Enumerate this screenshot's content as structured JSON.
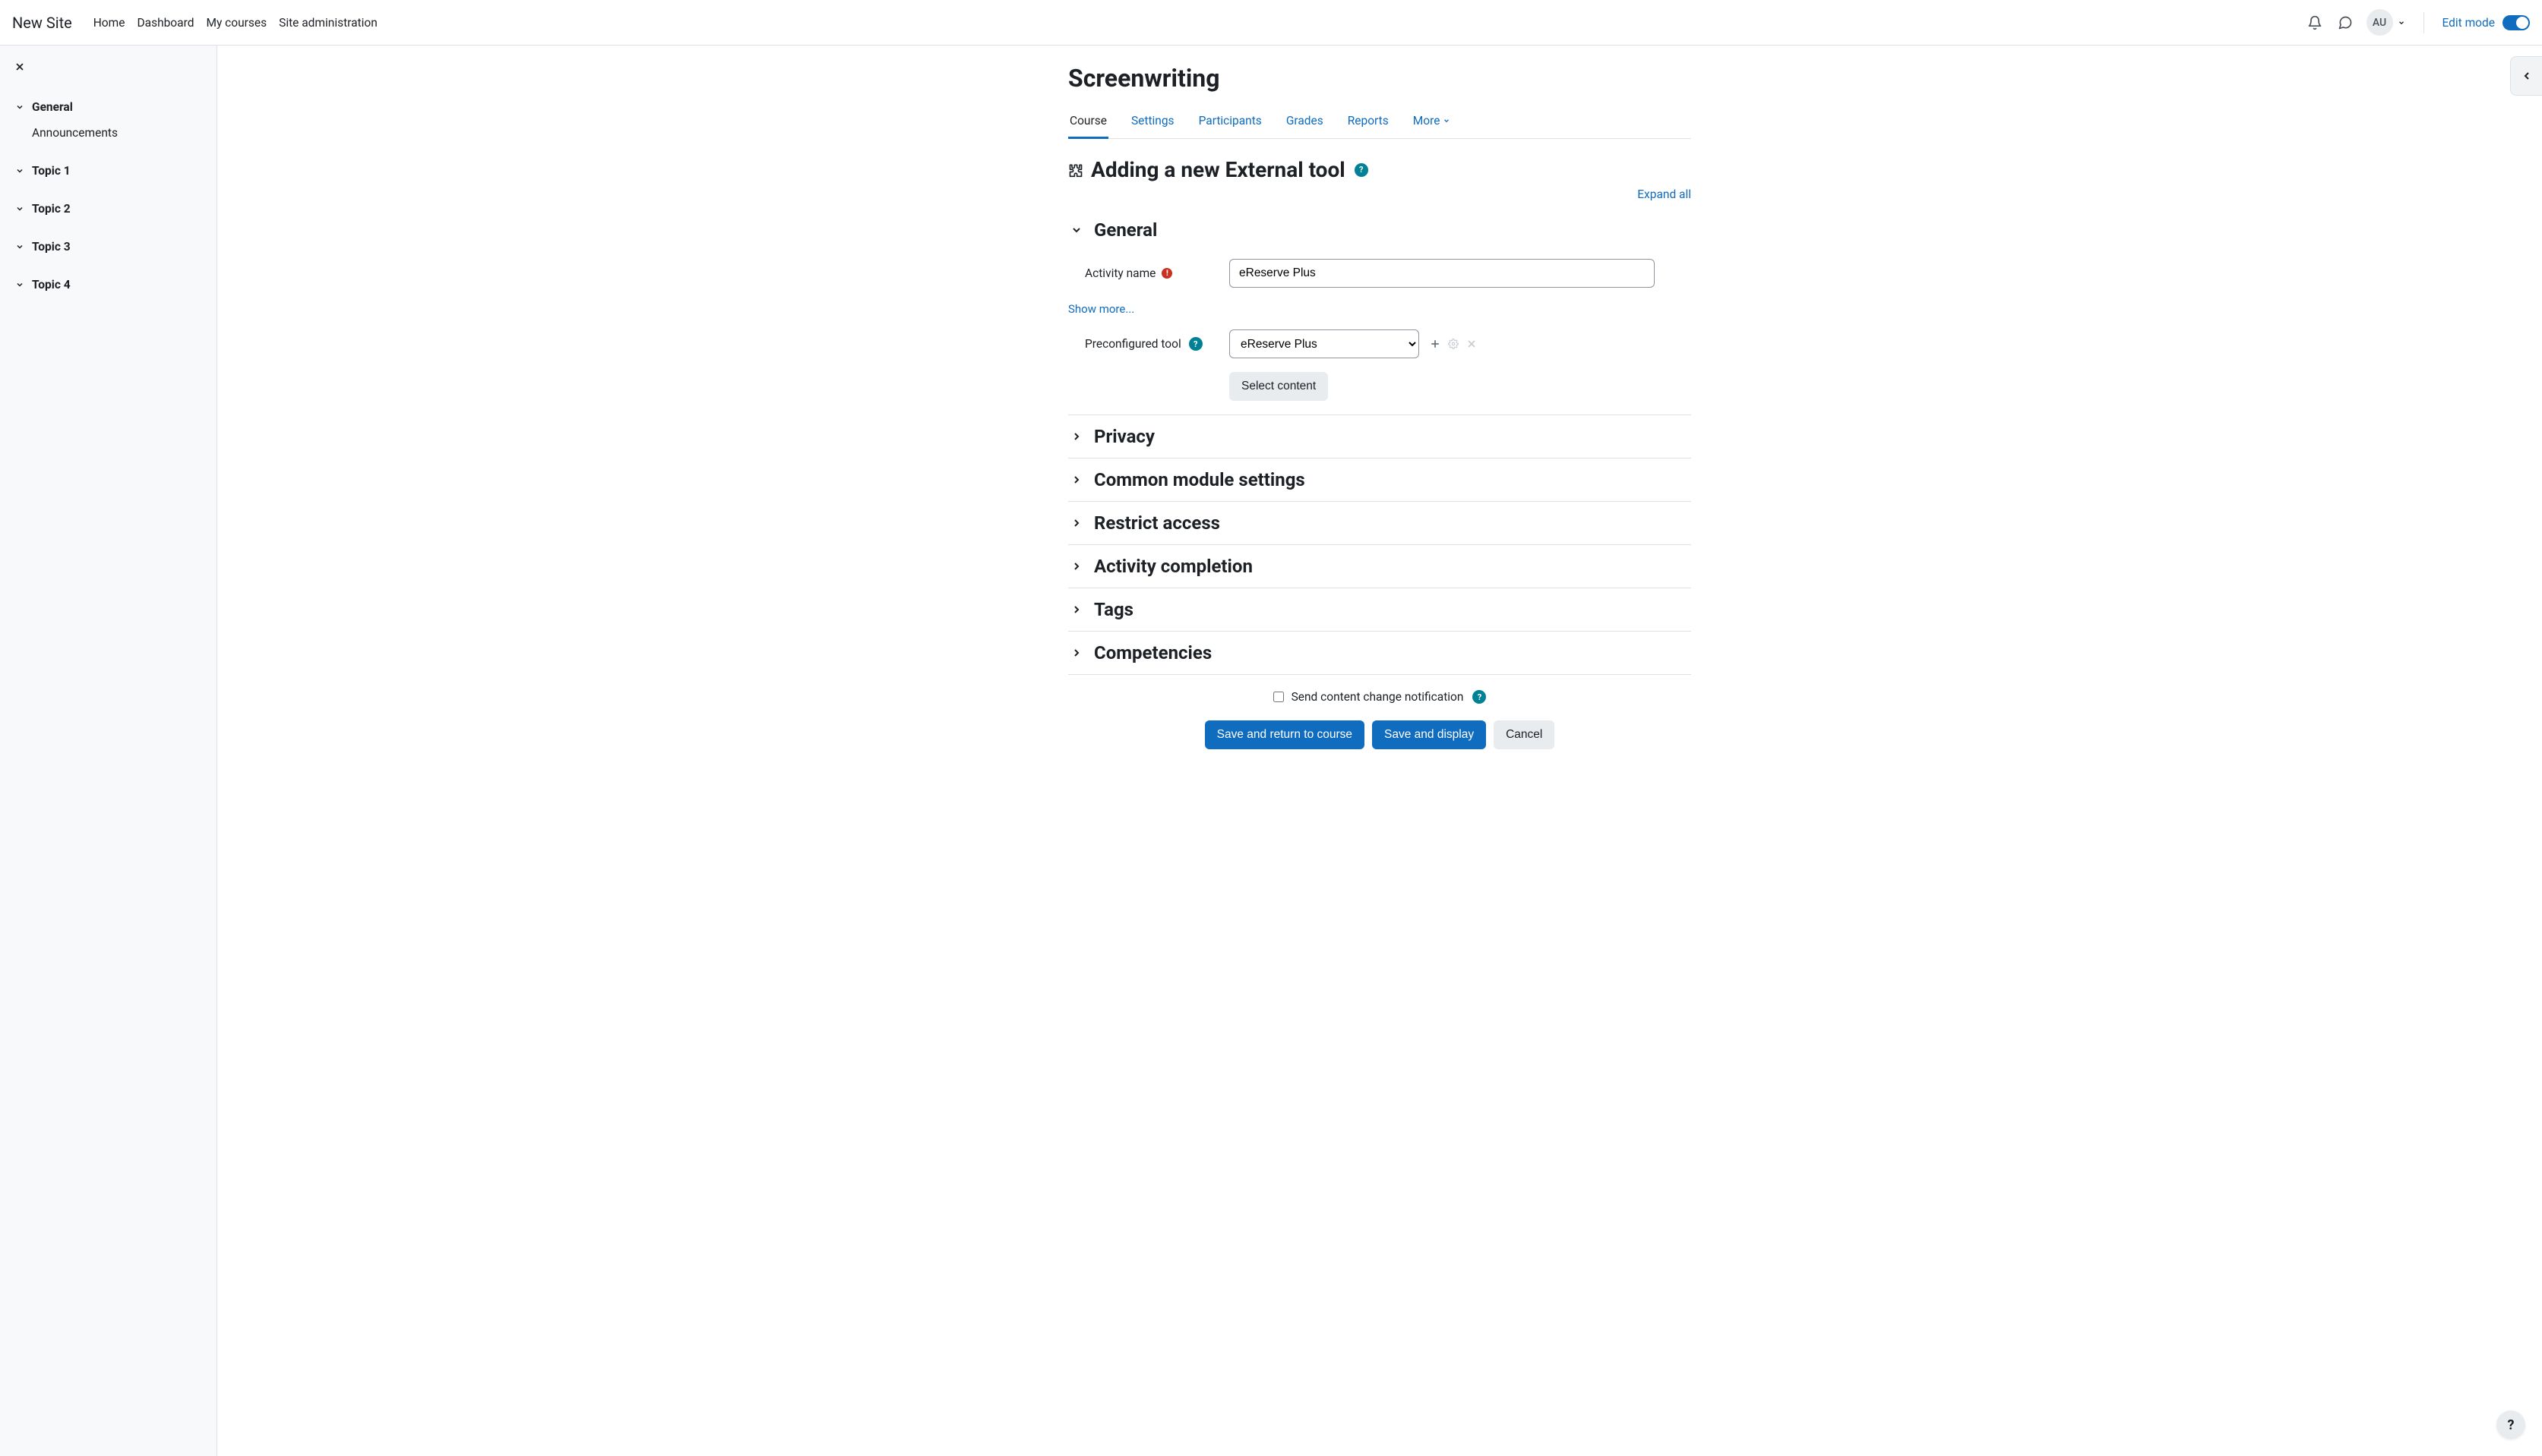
{
  "header": {
    "brand": "New Site",
    "nav": [
      "Home",
      "Dashboard",
      "My courses",
      "Site administration"
    ],
    "user_initials": "AU",
    "edit_mode_label": "Edit mode",
    "edit_mode_on": true
  },
  "drawer": {
    "sections": [
      {
        "label": "General",
        "expanded": true,
        "items": [
          "Announcements"
        ]
      },
      {
        "label": "Topic 1",
        "expanded": false,
        "items": []
      },
      {
        "label": "Topic 2",
        "expanded": false,
        "items": []
      },
      {
        "label": "Topic 3",
        "expanded": false,
        "items": []
      },
      {
        "label": "Topic 4",
        "expanded": false,
        "items": []
      }
    ]
  },
  "page": {
    "title": "Screenwriting",
    "tabs": [
      "Course",
      "Settings",
      "Participants",
      "Grades",
      "Reports",
      "More"
    ],
    "active_tab_index": 0,
    "form_heading": "Adding a new External tool",
    "expand_all": "Expand all",
    "show_more": "Show more..."
  },
  "form": {
    "general": {
      "title": "General",
      "activity_name_label": "Activity name",
      "activity_name_value": "eReserve Plus",
      "preconfigured_label": "Preconfigured tool",
      "preconfigured_value": "eReserve Plus",
      "select_content_label": "Select content"
    },
    "sections": [
      "Privacy",
      "Common module settings",
      "Restrict access",
      "Activity completion",
      "Tags",
      "Competencies"
    ],
    "notify_label": "Send content change notification",
    "buttons": {
      "save_return": "Save and return to course",
      "save_display": "Save and display",
      "cancel": "Cancel"
    }
  }
}
